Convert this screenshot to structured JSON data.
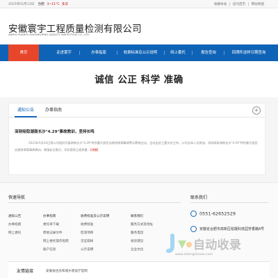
{
  "topbar": {
    "date": "2025年02月13日",
    "weather_icon": "weather-icon",
    "city": "合肥",
    "temp": "3~11°C",
    "weather": "多云",
    "links": [
      "收藏本站",
      "|",
      "设为首页",
      "|",
      "网站地图"
    ]
  },
  "header": {
    "company_cn": "安徽寰宇工程质量检测有限公司",
    "company_en": "ANHUI HUANYU ENGINEERING QUALITY INSPECTION CO., LTD"
  },
  "nav": {
    "items": [
      "首页",
      "走进寰宇",
      "办事指南",
      "收费标准及公示说明",
      "网上委托",
      "报告查询",
      "回溯件送样日期查询"
    ],
    "active_index": 0
  },
  "banner": {
    "slogan": "诚信 公正 科学 准确"
  },
  "news": {
    "tabs": [
      "通知公告",
      "办事指南"
    ],
    "more_icon": "plus-icon",
    "headline": "深刻吸取湖南长沙\"4.29\"事故教训，坚持长鸣",
    "body": "2023年5月24日我公司组织开展湖南长沙\"4.29\"特别重大居民自建房倒塌事故警示教育会议。会议由总工董文庆主持，公司全体人员参加，深刻吸取湖南长沙\"4·29\"特别重大居民自建房倒塌事故教训，增强安全意识，切实提高工程质量...",
    "detail_link": "[详细]"
  },
  "quick_links": {
    "title": "快速导航",
    "columns": [
      [
        "通知公告",
        "办事指南",
        "网上委托"
      ],
      [
        "办事指南",
        "委托单下载",
        "原始记录文件",
        "网上委托操作指南",
        "账户信息"
      ],
      [
        "收费标准及公示说明",
        "收费标准",
        "检测项目",
        "见证取样",
        "公示说明"
      ],
      [
        "联系我们",
        "服务方式及地址",
        "服务电话",
        "投诉建议",
        "企业文化"
      ]
    ]
  },
  "contact": {
    "title": "联系我们",
    "phone": "0551-62652529",
    "address": "安徽省合肥市高新区柏堰科技园芳香路8号"
  },
  "watermark": {
    "text": "自动收录",
    "url": "www.zidongshoulu.com"
  },
  "friend_links": {
    "title": "友情链接",
    "items": "安徽省住房和城乡建设厅官网"
  }
}
